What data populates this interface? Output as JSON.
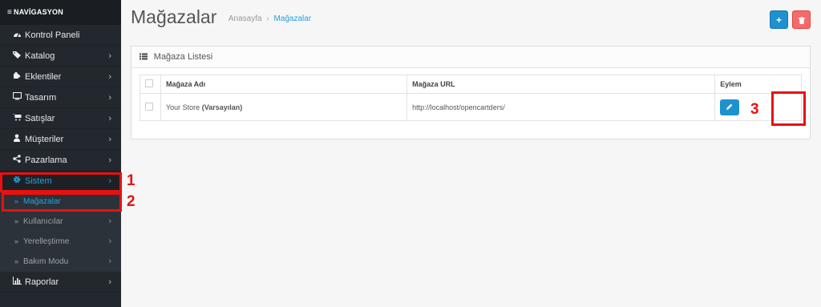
{
  "sidebar": {
    "heading": "NAVİGASYON",
    "items": [
      {
        "label": "Kontrol Paneli",
        "icon": "dashboard-icon",
        "glyph": "🎨",
        "chevron": ""
      },
      {
        "label": "Katalog",
        "icon": "tags-icon",
        "glyph": "🏷",
        "chevron": "›"
      },
      {
        "label": "Eklentiler",
        "icon": "puzzle-icon",
        "glyph": "✚",
        "chevron": "›"
      },
      {
        "label": "Tasarım",
        "icon": "monitor-icon",
        "glyph": "▭",
        "chevron": "›"
      },
      {
        "label": "Satışlar",
        "icon": "cart-icon",
        "glyph": "🛒",
        "chevron": "›"
      },
      {
        "label": "Müşteriler",
        "icon": "user-icon",
        "glyph": "👤",
        "chevron": "›"
      },
      {
        "label": "Pazarlama",
        "icon": "share-icon",
        "glyph": "⋖",
        "chevron": "›"
      },
      {
        "label": "Sistem",
        "icon": "cog-icon",
        "glyph": "⚙",
        "chevron": "›"
      }
    ],
    "sub_items": [
      {
        "label": "Mağazalar",
        "chevron": ""
      },
      {
        "label": "Kullanıcılar",
        "chevron": "›"
      },
      {
        "label": "Yerelleştirme",
        "chevron": "›"
      },
      {
        "label": "Bakım Modu",
        "chevron": "›"
      }
    ],
    "last_item": {
      "label": "Raporlar",
      "icon": "bar-chart-icon",
      "glyph": "📊",
      "chevron": "›"
    }
  },
  "header": {
    "title": "Mağazalar",
    "breadcrumb_home": "Anasayfa",
    "breadcrumb_sep": "›",
    "breadcrumb_current": "Mağazalar",
    "add_glyph": "+",
    "delete_glyph": "🗑"
  },
  "panel": {
    "title": "Mağaza Listesi",
    "columns": {
      "name": "Mağaza Adı",
      "url": "Mağaza URL",
      "action": "Eylem"
    },
    "rows": [
      {
        "name": "Your Store",
        "default_tag": "(Varsayılan)",
        "url": "http://localhost/opencartders/",
        "edit_glyph": "✎"
      }
    ]
  },
  "annotations": {
    "one": "1",
    "two": "2",
    "three": "3"
  },
  "colors": {
    "accent": "#2aa0d9",
    "annotation": "#e8110f",
    "sidebar_bg": "#23282e"
  }
}
